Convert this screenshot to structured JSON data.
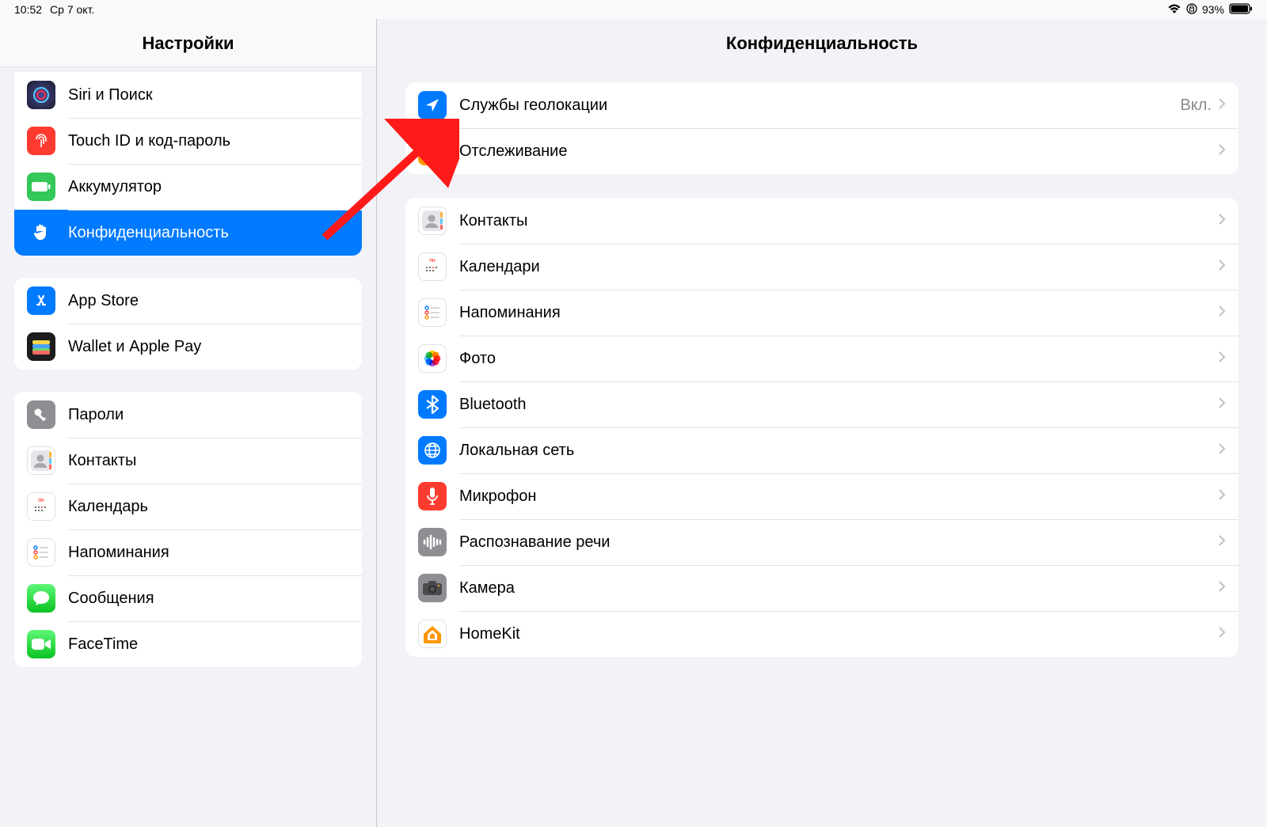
{
  "status": {
    "time": "10:52",
    "date": "Ср 7 окт.",
    "battery": "93%"
  },
  "sidebar": {
    "title": "Настройки",
    "groups": [
      {
        "items": [
          {
            "label": "Siri и Поиск",
            "icon": "siri-icon",
            "bg": "bg-siri"
          },
          {
            "label": "Touch ID и код-пароль",
            "icon": "fingerprint-icon",
            "bg": "bg-red"
          },
          {
            "label": "Аккумулятор",
            "icon": "battery-icon",
            "bg": "bg-green"
          },
          {
            "label": "Конфиденциальность",
            "icon": "hand-icon",
            "bg": "bg-blue",
            "selected": true
          }
        ]
      },
      {
        "items": [
          {
            "label": "App Store",
            "icon": "appstore-icon",
            "bg": "bg-blue"
          },
          {
            "label": "Wallet и Apple Pay",
            "icon": "wallet-icon",
            "bg": "bg-wallet"
          }
        ]
      },
      {
        "items": [
          {
            "label": "Пароли",
            "icon": "key-icon",
            "bg": "bg-gray"
          },
          {
            "label": "Контакты",
            "icon": "contacts-icon",
            "bg": "bg-white-b"
          },
          {
            "label": "Календарь",
            "icon": "calendar-icon",
            "bg": "bg-white-b"
          },
          {
            "label": "Напоминания",
            "icon": "reminders-icon",
            "bg": "bg-white-b"
          },
          {
            "label": "Сообщения",
            "icon": "messages-icon",
            "bg": "bg-msg"
          },
          {
            "label": "FaceTime",
            "icon": "facetime-icon",
            "bg": "bg-ft"
          }
        ]
      }
    ]
  },
  "main": {
    "title": "Конфиденциальность",
    "groups": [
      {
        "items": [
          {
            "label": "Службы геолокации",
            "value": "Вкл.",
            "icon": "location-icon",
            "bg": "bg-blue"
          },
          {
            "label": "Отслеживание",
            "icon": "tracking-icon",
            "bg": "bg-orange"
          }
        ]
      },
      {
        "items": [
          {
            "label": "Контакты",
            "icon": "contacts-icon",
            "bg": "bg-white-b"
          },
          {
            "label": "Календари",
            "icon": "calendar-icon",
            "bg": "bg-white-b"
          },
          {
            "label": "Напоминания",
            "icon": "reminders-icon",
            "bg": "bg-white-b"
          },
          {
            "label": "Фото",
            "icon": "photos-icon",
            "bg": "bg-photos"
          },
          {
            "label": "Bluetooth",
            "icon": "bluetooth-icon",
            "bg": "bg-blue"
          },
          {
            "label": "Локальная сеть",
            "icon": "network-icon",
            "bg": "bg-blue"
          },
          {
            "label": "Микрофон",
            "icon": "microphone-icon",
            "bg": "bg-red"
          },
          {
            "label": "Распознавание речи",
            "icon": "speech-icon",
            "bg": "bg-gray"
          },
          {
            "label": "Камера",
            "icon": "camera-icon",
            "bg": "bg-gray"
          },
          {
            "label": "HomeKit",
            "icon": "homekit-icon",
            "bg": "bg-white-b"
          }
        ]
      }
    ]
  }
}
